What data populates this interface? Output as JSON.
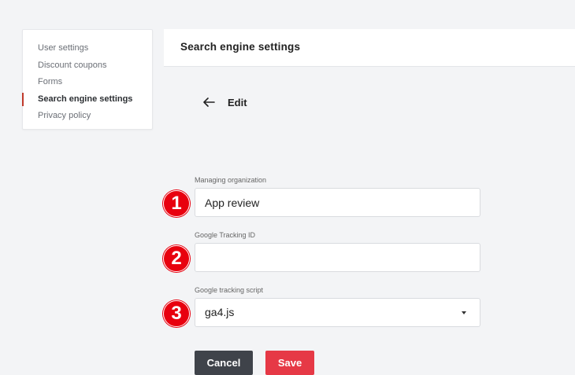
{
  "sidebar": {
    "items": [
      {
        "label": "User settings"
      },
      {
        "label": "Discount coupons"
      },
      {
        "label": "Forms"
      },
      {
        "label": "Search engine settings",
        "active": true
      },
      {
        "label": "Privacy policy"
      }
    ]
  },
  "header": {
    "title": "Search engine settings"
  },
  "edit": {
    "title": "Edit"
  },
  "form": {
    "managing_org": {
      "label": "Managing organization",
      "value": "App review"
    },
    "tracking_id": {
      "label": "Google Tracking ID",
      "value": ""
    },
    "tracking_script": {
      "label": "Google tracking script",
      "value": "ga4.js"
    }
  },
  "badges": [
    "1",
    "2",
    "3"
  ],
  "actions": {
    "cancel_label": "Cancel",
    "save_label": "Save"
  },
  "colors": {
    "accent": "#e63946",
    "badge": "#e8000e",
    "active_marker": "#c0392b",
    "dark_button": "#3f434a"
  }
}
